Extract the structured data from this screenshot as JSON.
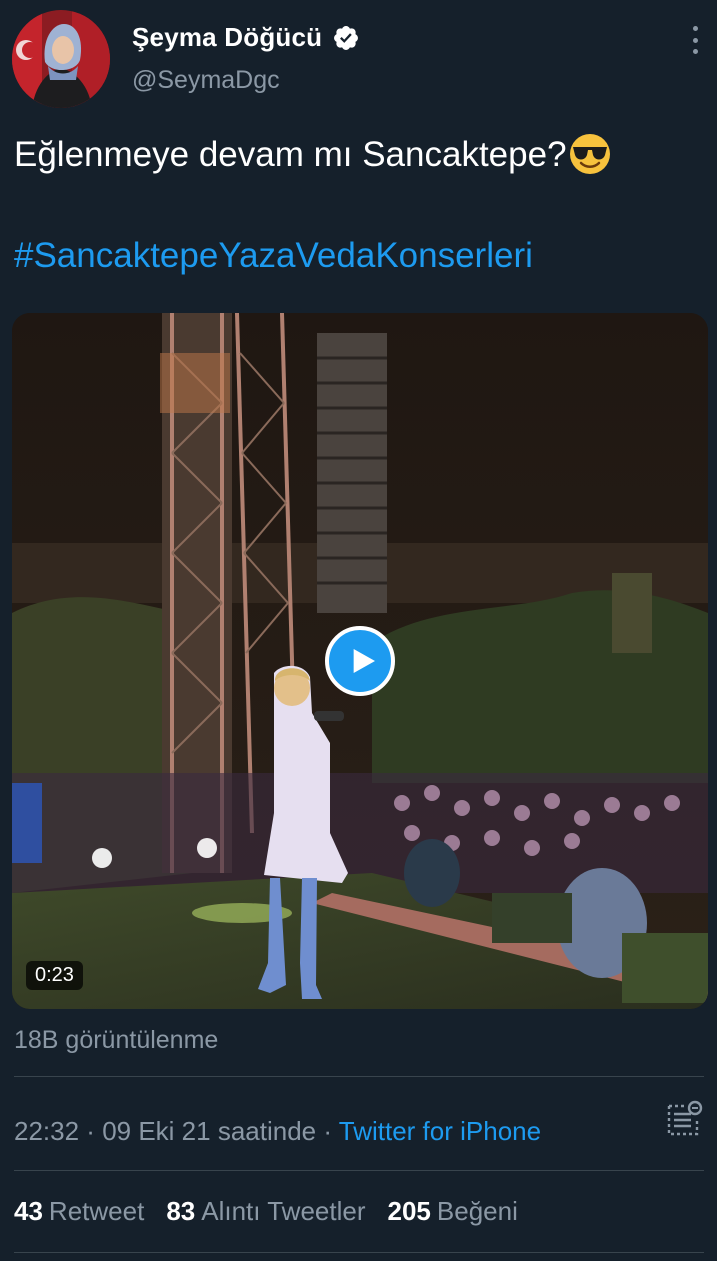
{
  "author": {
    "display_name": "Şeyma Döğücü",
    "handle": "@SeymaDgc",
    "verified": true,
    "avatar_icon": "profile-photo"
  },
  "tweet": {
    "text": "Eğlenmeye devam mı Sancaktepe?",
    "emoji": "smiling-face-with-sunglasses",
    "hashtag": "#SancaktepeYazaVedaKonserleri"
  },
  "media": {
    "type": "video",
    "duration": "0:23",
    "play_icon": "play-icon"
  },
  "views": "18B görüntülenme",
  "meta": {
    "time": "22:32",
    "sep1": " · ",
    "date": "09 Eki 21 saatinde",
    "sep2": " · ",
    "source": "Twitter for iPhone"
  },
  "stats": [
    {
      "count": "43",
      "label": "Retweet"
    },
    {
      "count": "83",
      "label": "Alıntı Tweetler"
    },
    {
      "count": "205",
      "label": "Beğeni"
    }
  ],
  "colors": {
    "background": "#15202b",
    "accent": "#1d9bf0",
    "secondary_text": "#8b98a5",
    "divider": "#38444d"
  }
}
